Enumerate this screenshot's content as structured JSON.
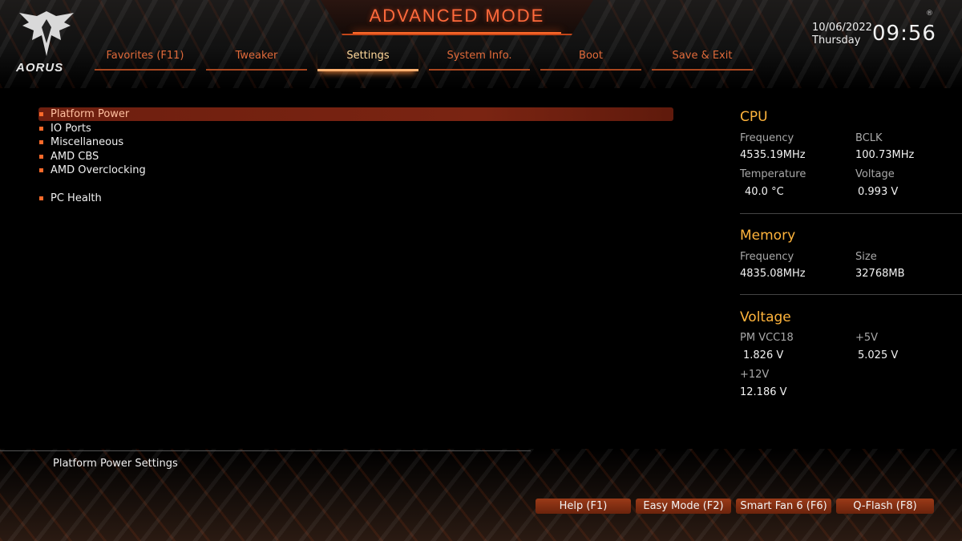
{
  "header": {
    "title": "ADVANCED MODE",
    "logo_text": "AORUS",
    "date": "10/06/2022",
    "day": "Thursday",
    "time": "09:56",
    "reg_mark": "®"
  },
  "tabs": [
    {
      "label": "Favorites (F11)",
      "active": false
    },
    {
      "label": "Tweaker",
      "active": false
    },
    {
      "label": "Settings",
      "active": true
    },
    {
      "label": "System Info.",
      "active": false
    },
    {
      "label": "Boot",
      "active": false
    },
    {
      "label": "Save & Exit",
      "active": false
    }
  ],
  "menu": {
    "items": [
      {
        "label": "Platform Power",
        "selected": true
      },
      {
        "label": "IO Ports",
        "selected": false
      },
      {
        "label": "Miscellaneous",
        "selected": false
      },
      {
        "label": "AMD CBS",
        "selected": false
      },
      {
        "label": "AMD Overclocking",
        "selected": false
      },
      {
        "label": "PC Health",
        "selected": false
      }
    ]
  },
  "help": {
    "text": "Platform Power Settings"
  },
  "info": {
    "cpu": {
      "title": "CPU",
      "frequency_label": "Frequency",
      "frequency": "4535.19MHz",
      "bclk_label": "BCLK",
      "bclk": "100.73MHz",
      "temperature_label": "Temperature",
      "temperature": "40.0 °C",
      "voltage_label": "Voltage",
      "voltage": "0.993 V"
    },
    "memory": {
      "title": "Memory",
      "frequency_label": "Frequency",
      "frequency": "4835.08MHz",
      "size_label": "Size",
      "size": "32768MB"
    },
    "voltage": {
      "title": "Voltage",
      "pm_vcc18_label": "PM VCC18",
      "pm_vcc18": "1.826 V",
      "p5v_label": "+5V",
      "p5v": "5.025 V",
      "p12v_label": "+12V",
      "p12v": "12.186 V"
    }
  },
  "bottom_buttons": [
    {
      "label": "Help (F1)"
    },
    {
      "label": "Easy Mode (F2)"
    },
    {
      "label": "Smart Fan 6 (F6)"
    },
    {
      "label": "Q-Flash (F8)"
    }
  ],
  "colors": {
    "accent": "#ff6a2a",
    "section_title": "#ffb43c",
    "selected_row": "#7a2412"
  }
}
